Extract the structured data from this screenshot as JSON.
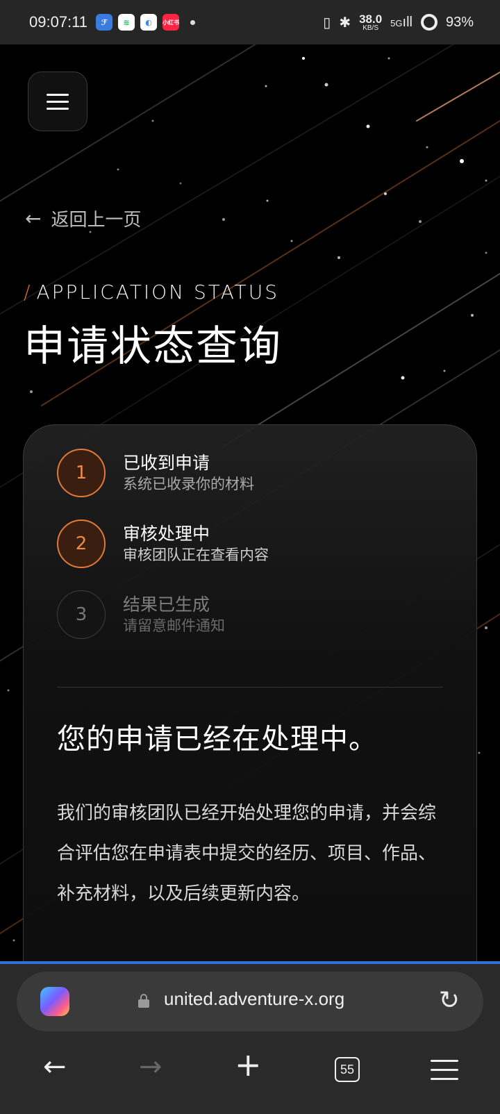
{
  "status_bar": {
    "time": "09:07:11",
    "app_icons": [
      {
        "name": "app-icon-1",
        "color": "#3a7be0",
        "glyph": "ℱ"
      },
      {
        "name": "spotify-icon",
        "color": "#1db954",
        "glyph": "≋"
      },
      {
        "name": "app-icon-3",
        "color": "#2f8cf0",
        "glyph": "◐"
      },
      {
        "name": "xiaohongshu-icon",
        "color": "#ff2442",
        "glyph": "小红书"
      }
    ],
    "net_speed": "38.0",
    "net_unit": "KB/S",
    "signal": "5G",
    "battery": "93%"
  },
  "page": {
    "back_label": "返回上一页",
    "eyebrow": "APPLICATION STATUS",
    "title": "申请状态查询"
  },
  "steps": [
    {
      "num": "1",
      "title": "已收到申请",
      "desc": "系统已收录你的材料",
      "state": "done"
    },
    {
      "num": "2",
      "title": "审核处理中",
      "desc": "审核团队正在查看内容",
      "state": "current"
    },
    {
      "num": "3",
      "title": "结果已生成",
      "desc": "请留意邮件通知",
      "state": "pending"
    }
  ],
  "message": {
    "heading": "您的申请已经在处理中。",
    "body": "我们的审核团队已经开始处理您的申请，并会综合评估您在申请表中提交的经历、项目、作品、补充材料，以及后续更新内容。"
  },
  "browser": {
    "url": "united.adventure-x.org",
    "tab_count": "55",
    "progress_color": "#2e6fd8"
  },
  "colors": {
    "accent": "#e07a3a",
    "background": "#000000"
  }
}
